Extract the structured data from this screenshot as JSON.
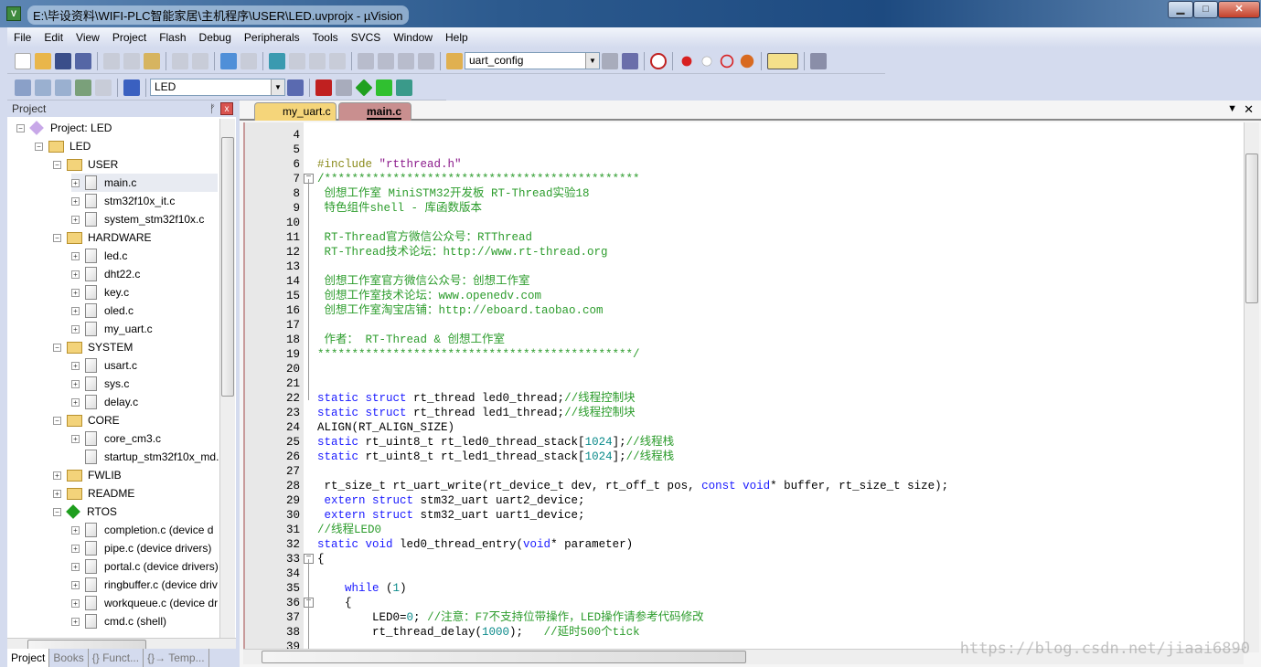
{
  "window": {
    "title": "E:\\毕设资料\\WIFI-PLC智能家居\\主机程序\\USER\\LED.uvprojx - µVision",
    "minimize": "▁",
    "maximize": "□",
    "close": "✕"
  },
  "menu": [
    "File",
    "Edit",
    "View",
    "Project",
    "Flash",
    "Debug",
    "Peripherals",
    "Tools",
    "SVCS",
    "Window",
    "Help"
  ],
  "toolbar1": {
    "find_combo": "uart_config"
  },
  "toolbar2": {
    "target_combo": "LED"
  },
  "project_panel": {
    "title": "Project",
    "pin": "ᚠ",
    "close": "x",
    "tree": [
      {
        "label": "Project: LED",
        "level": 0,
        "type": "root",
        "toggle": "−"
      },
      {
        "label": "LED",
        "level": 1,
        "type": "target",
        "toggle": "−"
      },
      {
        "label": "USER",
        "level": 2,
        "type": "folder",
        "toggle": "−"
      },
      {
        "label": "main.c",
        "level": 3,
        "type": "file",
        "toggle": "+",
        "selected": true
      },
      {
        "label": "stm32f10x_it.c",
        "level": 3,
        "type": "file",
        "toggle": "+"
      },
      {
        "label": "system_stm32f10x.c",
        "level": 3,
        "type": "file",
        "toggle": "+"
      },
      {
        "label": "HARDWARE",
        "level": 2,
        "type": "folder",
        "toggle": "−"
      },
      {
        "label": "led.c",
        "level": 3,
        "type": "file",
        "toggle": "+"
      },
      {
        "label": "dht22.c",
        "level": 3,
        "type": "file",
        "toggle": "+"
      },
      {
        "label": "key.c",
        "level": 3,
        "type": "file",
        "toggle": "+"
      },
      {
        "label": "oled.c",
        "level": 3,
        "type": "file",
        "toggle": "+"
      },
      {
        "label": "my_uart.c",
        "level": 3,
        "type": "file",
        "toggle": "+"
      },
      {
        "label": "SYSTEM",
        "level": 2,
        "type": "folder",
        "toggle": "−"
      },
      {
        "label": "usart.c",
        "level": 3,
        "type": "file",
        "toggle": "+"
      },
      {
        "label": "sys.c",
        "level": 3,
        "type": "file",
        "toggle": "+"
      },
      {
        "label": "delay.c",
        "level": 3,
        "type": "file",
        "toggle": "+"
      },
      {
        "label": "CORE",
        "level": 2,
        "type": "folder",
        "toggle": "−"
      },
      {
        "label": "core_cm3.c",
        "level": 3,
        "type": "file",
        "toggle": "+"
      },
      {
        "label": "startup_stm32f10x_md.",
        "level": 3,
        "type": "file",
        "toggle": ""
      },
      {
        "label": "FWLIB",
        "level": 2,
        "type": "folder",
        "toggle": "+"
      },
      {
        "label": "README",
        "level": 2,
        "type": "folder",
        "toggle": "+"
      },
      {
        "label": "RTOS",
        "level": 2,
        "type": "group",
        "toggle": "−"
      },
      {
        "label": "completion.c (device d",
        "level": 3,
        "type": "file",
        "toggle": "+"
      },
      {
        "label": "pipe.c (device drivers)",
        "level": 3,
        "type": "file",
        "toggle": "+"
      },
      {
        "label": "portal.c (device drivers)",
        "level": 3,
        "type": "file",
        "toggle": "+"
      },
      {
        "label": "ringbuffer.c (device driv",
        "level": 3,
        "type": "file",
        "toggle": "+"
      },
      {
        "label": "workqueue.c (device dr",
        "level": 3,
        "type": "file",
        "toggle": "+"
      },
      {
        "label": "cmd.c (shell)",
        "level": 3,
        "type": "file",
        "toggle": "+"
      }
    ],
    "bottom_tabs": [
      "Project",
      "Books",
      "{} Funct...",
      "{}→ Temp..."
    ]
  },
  "editor": {
    "tabs": [
      {
        "label": "my_uart.c",
        "active": false
      },
      {
        "label": "main.c",
        "active": true
      }
    ],
    "tab_menu": "▼",
    "tab_close": "✕",
    "lines": [
      {
        "n": "4",
        "seg": []
      },
      {
        "n": "5",
        "seg": []
      },
      {
        "n": "6",
        "seg": [
          [
            "#include ",
            "pp"
          ],
          [
            "\"rtthread.h\"",
            "str"
          ]
        ]
      },
      {
        "n": "7",
        "fold": true,
        "seg": [
          [
            "/**********************************************",
            "cm"
          ]
        ]
      },
      {
        "n": "8",
        "seg": [
          [
            " 创想工作室 MiniSTM32开发板 RT-Thread实验18",
            "cm"
          ]
        ]
      },
      {
        "n": "9",
        "seg": [
          [
            " 特色组件shell - 库函数版本",
            "cm"
          ]
        ]
      },
      {
        "n": "10",
        "seg": []
      },
      {
        "n": "11",
        "seg": [
          [
            " RT-Thread官方微信公众号：RTThread",
            "cm"
          ]
        ]
      },
      {
        "n": "12",
        "seg": [
          [
            " RT-Thread技术论坛：http://www.rt-thread.org",
            "cm"
          ]
        ]
      },
      {
        "n": "13",
        "seg": []
      },
      {
        "n": "14",
        "seg": [
          [
            " 创想工作室官方微信公众号：创想工作室",
            "cm"
          ]
        ]
      },
      {
        "n": "15",
        "seg": [
          [
            " 创想工作室技术论坛：www.openedv.com",
            "cm"
          ]
        ]
      },
      {
        "n": "16",
        "seg": [
          [
            " 创想工作室淘宝店铺：http://eboard.taobao.com",
            "cm"
          ]
        ]
      },
      {
        "n": "17",
        "seg": []
      },
      {
        "n": "18",
        "seg": [
          [
            " 作者： RT-Thread & 创想工作室",
            "cm"
          ]
        ]
      },
      {
        "n": "19",
        "seg": [
          [
            "**********************************************/",
            "cm"
          ]
        ]
      },
      {
        "n": "20",
        "seg": []
      },
      {
        "n": "21",
        "seg": []
      },
      {
        "n": "22",
        "seg": [
          [
            "static struct",
            "kw"
          ],
          [
            " rt_thread led0_thread;",
            ""
          ],
          [
            "//线程控制块",
            "cm"
          ]
        ]
      },
      {
        "n": "23",
        "seg": [
          [
            "static struct",
            "kw"
          ],
          [
            " rt_thread led1_thread;",
            ""
          ],
          [
            "//线程控制块",
            "cm"
          ]
        ]
      },
      {
        "n": "24",
        "seg": [
          [
            "ALIGN(RT_ALIGN_SIZE)",
            ""
          ]
        ]
      },
      {
        "n": "25",
        "seg": [
          [
            "static",
            "kw"
          ],
          [
            " rt_uint8_t rt_led0_thread_stack[",
            ""
          ],
          [
            "1024",
            "num"
          ],
          [
            "];",
            ""
          ],
          [
            "//线程栈",
            "cm"
          ]
        ]
      },
      {
        "n": "26",
        "seg": [
          [
            "static",
            "kw"
          ],
          [
            " rt_uint8_t rt_led1_thread_stack[",
            ""
          ],
          [
            "1024",
            "num"
          ],
          [
            "];",
            ""
          ],
          [
            "//线程栈",
            "cm"
          ]
        ]
      },
      {
        "n": "27",
        "seg": []
      },
      {
        "n": "28",
        "seg": [
          [
            " rt_size_t rt_uart_write(rt_device_t dev, rt_off_t pos, ",
            ""
          ],
          [
            "const void",
            "kw"
          ],
          [
            "* buffer, rt_size_t size);",
            ""
          ]
        ]
      },
      {
        "n": "29",
        "seg": [
          [
            " extern struct",
            "kw"
          ],
          [
            " stm32_uart uart2_device;",
            ""
          ]
        ]
      },
      {
        "n": "30",
        "seg": [
          [
            " extern struct",
            "kw"
          ],
          [
            " stm32_uart uart1_device;",
            ""
          ]
        ]
      },
      {
        "n": "31",
        "seg": [
          [
            "//线程LED0",
            "cm"
          ]
        ]
      },
      {
        "n": "32",
        "seg": [
          [
            "static void",
            "kw"
          ],
          [
            " led0_thread_entry(",
            ""
          ],
          [
            "void",
            "kw"
          ],
          [
            "* parameter)",
            ""
          ]
        ]
      },
      {
        "n": "33",
        "fold": true,
        "seg": [
          [
            "{",
            ""
          ]
        ]
      },
      {
        "n": "34",
        "seg": []
      },
      {
        "n": "35",
        "seg": [
          [
            "    ",
            ""
          ],
          [
            "while",
            "kw"
          ],
          [
            " (",
            ""
          ],
          [
            "1",
            "num"
          ],
          [
            ")",
            ""
          ]
        ]
      },
      {
        "n": "36",
        "fold": true,
        "seg": [
          [
            "    {",
            ""
          ]
        ]
      },
      {
        "n": "37",
        "seg": [
          [
            "        LED0=",
            ""
          ],
          [
            "0",
            "num"
          ],
          [
            "; ",
            ""
          ],
          [
            "//注意：F7不支持位带操作，LED操作请参考代码修改",
            "cm"
          ]
        ]
      },
      {
        "n": "38",
        "seg": [
          [
            "        rt_thread_delay(",
            ""
          ],
          [
            "1000",
            "num"
          ],
          [
            ");   ",
            ""
          ],
          [
            "//延时500个tick",
            "cm"
          ]
        ]
      },
      {
        "n": "39",
        "seg": []
      }
    ]
  },
  "watermark": "https://blog.csdn.net/jiaai6890",
  "colors": {
    "keyword": "#1a1aff",
    "comment": "#2c9c2c",
    "preprocessor": "#8a8a1a",
    "string": "#8b1a8b",
    "number": "#0a8a8a",
    "active_tab": "#c98f8f",
    "inactive_tab": "#f5d57a"
  }
}
